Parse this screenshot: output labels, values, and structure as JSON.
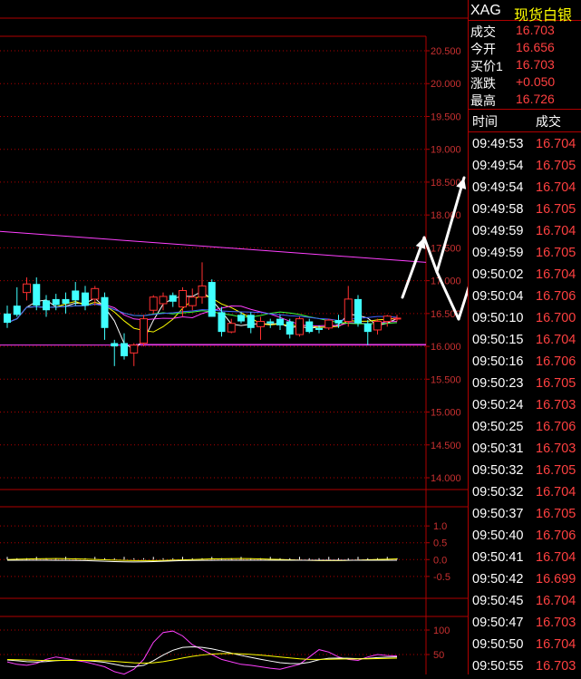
{
  "quote": {
    "symbol": "XAG",
    "name": "现货白银",
    "rows": [
      {
        "label": "成交",
        "value": "16.703"
      },
      {
        "label": "今开",
        "value": "16.656"
      },
      {
        "label": "买价1",
        "value": "16.703"
      },
      {
        "label": "涨跌",
        "value": "+0.050"
      },
      {
        "label": "最高",
        "value": "16.726"
      }
    ]
  },
  "ticks": {
    "col_time": "时间",
    "col_price": "成交",
    "rows": [
      {
        "time": "09:49:53",
        "price": "16.704"
      },
      {
        "time": "09:49:54",
        "price": "16.705"
      },
      {
        "time": "09:49:54",
        "price": "16.704"
      },
      {
        "time": "09:49:58",
        "price": "16.705"
      },
      {
        "time": "09:49:59",
        "price": "16.704"
      },
      {
        "time": "09:49:59",
        "price": "16.705"
      },
      {
        "time": "09:50:02",
        "price": "16.704"
      },
      {
        "time": "09:50:04",
        "price": "16.706"
      },
      {
        "time": "09:50:10",
        "price": "16.700"
      },
      {
        "time": "09:50:15",
        "price": "16.704"
      },
      {
        "time": "09:50:16",
        "price": "16.706"
      },
      {
        "time": "09:50:23",
        "price": "16.705"
      },
      {
        "time": "09:50:24",
        "price": "16.703"
      },
      {
        "time": "09:50:25",
        "price": "16.706"
      },
      {
        "time": "09:50:31",
        "price": "16.703"
      },
      {
        "time": "09:50:32",
        "price": "16.705"
      },
      {
        "time": "09:50:32",
        "price": "16.704"
      },
      {
        "time": "09:50:37",
        "price": "16.705"
      },
      {
        "time": "09:50:40",
        "price": "16.706"
      },
      {
        "time": "09:50:41",
        "price": "16.704"
      },
      {
        "time": "09:50:42",
        "price": "16.699"
      },
      {
        "time": "09:50:45",
        "price": "16.704"
      },
      {
        "time": "09:50:47",
        "price": "16.703"
      },
      {
        "time": "09:50:50",
        "price": "16.704"
      },
      {
        "time": "09:50:55",
        "price": "16.703"
      }
    ]
  },
  "colors": {
    "up": "#ff3030",
    "down": "#40ffff",
    "grid": "#b00000",
    "axis_text": "#c83030",
    "trendline": "#ff40ff",
    "arrows": "#ffffff"
  },
  "chart_data": [
    {
      "type": "candlestick",
      "y_ticks": [
        "20.500",
        "20.000",
        "19.500",
        "19.000",
        "18.500",
        "18.000",
        "17.500",
        "17.000",
        "16.500",
        "16.000",
        "15.500",
        "15.000",
        "14.500",
        "14.000"
      ],
      "ylim": [
        14.0,
        20.5
      ],
      "grid": true,
      "candles": [
        {
          "o": 16.5,
          "h": 16.62,
          "l": 16.28,
          "c": 16.36
        },
        {
          "o": 16.62,
          "h": 16.9,
          "l": 16.45,
          "c": 16.48
        },
        {
          "o": 16.82,
          "h": 17.05,
          "l": 16.7,
          "c": 16.95
        },
        {
          "o": 16.95,
          "h": 17.05,
          "l": 16.55,
          "c": 16.62
        },
        {
          "o": 16.7,
          "h": 16.78,
          "l": 16.45,
          "c": 16.55
        },
        {
          "o": 16.72,
          "h": 16.8,
          "l": 16.55,
          "c": 16.63
        },
        {
          "o": 16.72,
          "h": 16.82,
          "l": 16.5,
          "c": 16.65
        },
        {
          "o": 16.85,
          "h": 16.98,
          "l": 16.62,
          "c": 16.7
        },
        {
          "o": 16.82,
          "h": 16.92,
          "l": 16.55,
          "c": 16.62
        },
        {
          "o": 16.72,
          "h": 16.92,
          "l": 16.62,
          "c": 16.88
        },
        {
          "o": 16.75,
          "h": 16.82,
          "l": 16.1,
          "c": 16.28
        },
        {
          "o": 16.05,
          "h": 16.1,
          "l": 15.7,
          "c": 16.0
        },
        {
          "o": 16.05,
          "h": 16.2,
          "l": 15.8,
          "c": 15.85
        },
        {
          "o": 15.9,
          "h": 16.05,
          "l": 15.7,
          "c": 16.02
        },
        {
          "o": 16.05,
          "h": 16.48,
          "l": 16.0,
          "c": 16.42
        },
        {
          "o": 16.55,
          "h": 16.78,
          "l": 16.5,
          "c": 16.75
        },
        {
          "o": 16.65,
          "h": 16.82,
          "l": 16.55,
          "c": 16.76
        },
        {
          "o": 16.78,
          "h": 16.82,
          "l": 16.6,
          "c": 16.68
        },
        {
          "o": 16.6,
          "h": 16.9,
          "l": 16.45,
          "c": 16.85
        },
        {
          "o": 16.62,
          "h": 16.88,
          "l": 16.55,
          "c": 16.75
        },
        {
          "o": 16.75,
          "h": 17.28,
          "l": 16.65,
          "c": 16.92
        },
        {
          "o": 16.98,
          "h": 17.02,
          "l": 16.45,
          "c": 16.45
        },
        {
          "o": 16.52,
          "h": 16.6,
          "l": 16.15,
          "c": 16.22
        },
        {
          "o": 16.22,
          "h": 16.42,
          "l": 16.2,
          "c": 16.35
        },
        {
          "o": 16.48,
          "h": 16.52,
          "l": 16.35,
          "c": 16.38
        },
        {
          "o": 16.48,
          "h": 16.52,
          "l": 16.2,
          "c": 16.28
        },
        {
          "o": 16.3,
          "h": 16.45,
          "l": 16.1,
          "c": 16.38
        },
        {
          "o": 16.38,
          "h": 16.42,
          "l": 16.28,
          "c": 16.35
        },
        {
          "o": 16.42,
          "h": 16.48,
          "l": 16.25,
          "c": 16.32
        },
        {
          "o": 16.38,
          "h": 16.42,
          "l": 16.12,
          "c": 16.18
        },
        {
          "o": 16.18,
          "h": 16.45,
          "l": 16.15,
          "c": 16.42
        },
        {
          "o": 16.38,
          "h": 16.42,
          "l": 16.2,
          "c": 16.22
        },
        {
          "o": 16.28,
          "h": 16.32,
          "l": 16.2,
          "c": 16.25
        },
        {
          "o": 16.28,
          "h": 16.42,
          "l": 16.25,
          "c": 16.4
        },
        {
          "o": 16.4,
          "h": 16.48,
          "l": 16.28,
          "c": 16.35
        },
        {
          "o": 16.38,
          "h": 16.92,
          "l": 16.3,
          "c": 16.72
        },
        {
          "o": 16.72,
          "h": 16.78,
          "l": 16.3,
          "c": 16.35
        },
        {
          "o": 16.35,
          "h": 16.4,
          "l": 16.02,
          "c": 16.22
        },
        {
          "o": 16.25,
          "h": 16.42,
          "l": 16.18,
          "c": 16.38
        },
        {
          "o": 16.38,
          "h": 16.48,
          "l": 16.3,
          "c": 16.46
        },
        {
          "o": 16.42,
          "h": 16.48,
          "l": 16.38,
          "c": 16.43
        }
      ],
      "support_level": 16.02,
      "trendline": {
        "start": 17.75,
        "end": 17.28
      }
    },
    {
      "type": "line",
      "y_ticks": [
        "1.0",
        "0.5",
        "0.0",
        "-0.5"
      ],
      "ylim": [
        -0.8,
        1.3
      ]
    },
    {
      "type": "line",
      "y_ticks": [
        "100",
        "50"
      ],
      "ylim": [
        0,
        120
      ]
    }
  ]
}
